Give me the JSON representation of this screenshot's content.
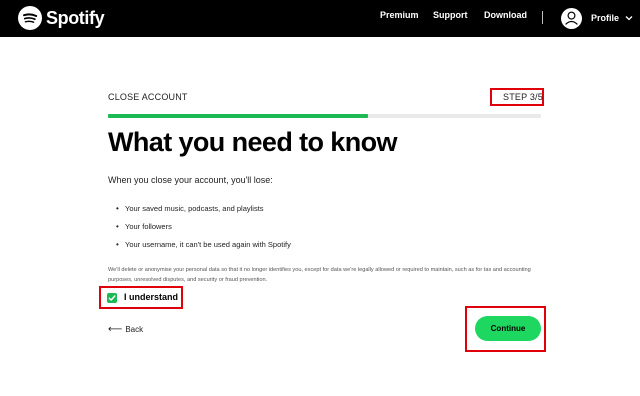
{
  "header": {
    "brand": "Spotify",
    "nav": [
      {
        "label": "Premium"
      },
      {
        "label": "Support"
      },
      {
        "label": "Download"
      }
    ],
    "profile_label": "Profile"
  },
  "step": {
    "title": "CLOSE ACCOUNT",
    "count": "STEP 3/5",
    "progress": 0.6
  },
  "main": {
    "heading": "What you need to know",
    "intro": "When you close your account, you'll lose:",
    "items": [
      {
        "text": "Your saved music, podcasts, and playlists"
      },
      {
        "text": "Your followers"
      },
      {
        "text": "Your username, it can't be used again with Spotify"
      }
    ],
    "disclaimer": "We'll delete or anonymise your personal data so that it no longer identifies you, except for data we're legally allowed or required to maintain, such as for tax and accounting purposes, unresolved disputes, and security or fraud prevention.",
    "checkbox_label": "I understand",
    "checkbox_checked": true
  },
  "actions": {
    "back_label": "Back",
    "continue_label": "Continue"
  },
  "colors": {
    "brand_green": "#1ed760",
    "progress_green": "#1db954",
    "highlight_red": "#e0000b",
    "header_bg": "#000000"
  },
  "icons": {
    "logo": "spotify-logo-icon",
    "avatar": "user-icon",
    "caret": "chevron-down-icon",
    "check": "check-icon",
    "back": "arrow-left-icon"
  }
}
